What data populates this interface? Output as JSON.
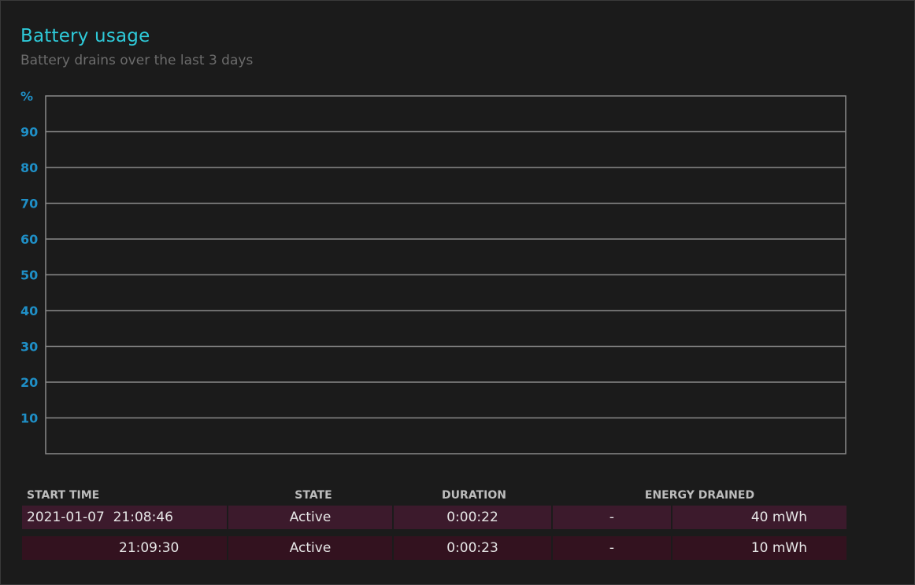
{
  "report": {
    "title": "Battery usage",
    "subtitle": "Battery drains over the last 3 days"
  },
  "chart_data": {
    "type": "line",
    "ylabel": "%",
    "ylim": [
      0,
      100
    ],
    "y_ticks": [
      "90",
      "80",
      "70",
      "60",
      "50",
      "40",
      "30",
      "20",
      "10"
    ],
    "grid": true,
    "series": [],
    "colors": {
      "tick_text": "#1f8fc6",
      "grid": "#8a8a8a"
    }
  },
  "table": {
    "headers": {
      "start_time": "START TIME",
      "state": "STATE",
      "duration": "DURATION",
      "energy_drained": "ENERGY DRAINED"
    },
    "rows": [
      {
        "start_time": "2021-01-07  21:08:46",
        "state": "Active",
        "duration": "0:00:22",
        "percent": "-",
        "energy": "40 mWh"
      },
      {
        "start_time": "21:09:30",
        "state": "Active",
        "duration": "0:00:23",
        "percent": "-",
        "energy": "10 mWh"
      }
    ]
  },
  "colors": {
    "title": "#2ec9d8",
    "subtitle": "#6c6c6c",
    "background": "#1b1b1b",
    "row_1_bg": "#3c1a2c",
    "row_2_bg": "#33121f"
  }
}
